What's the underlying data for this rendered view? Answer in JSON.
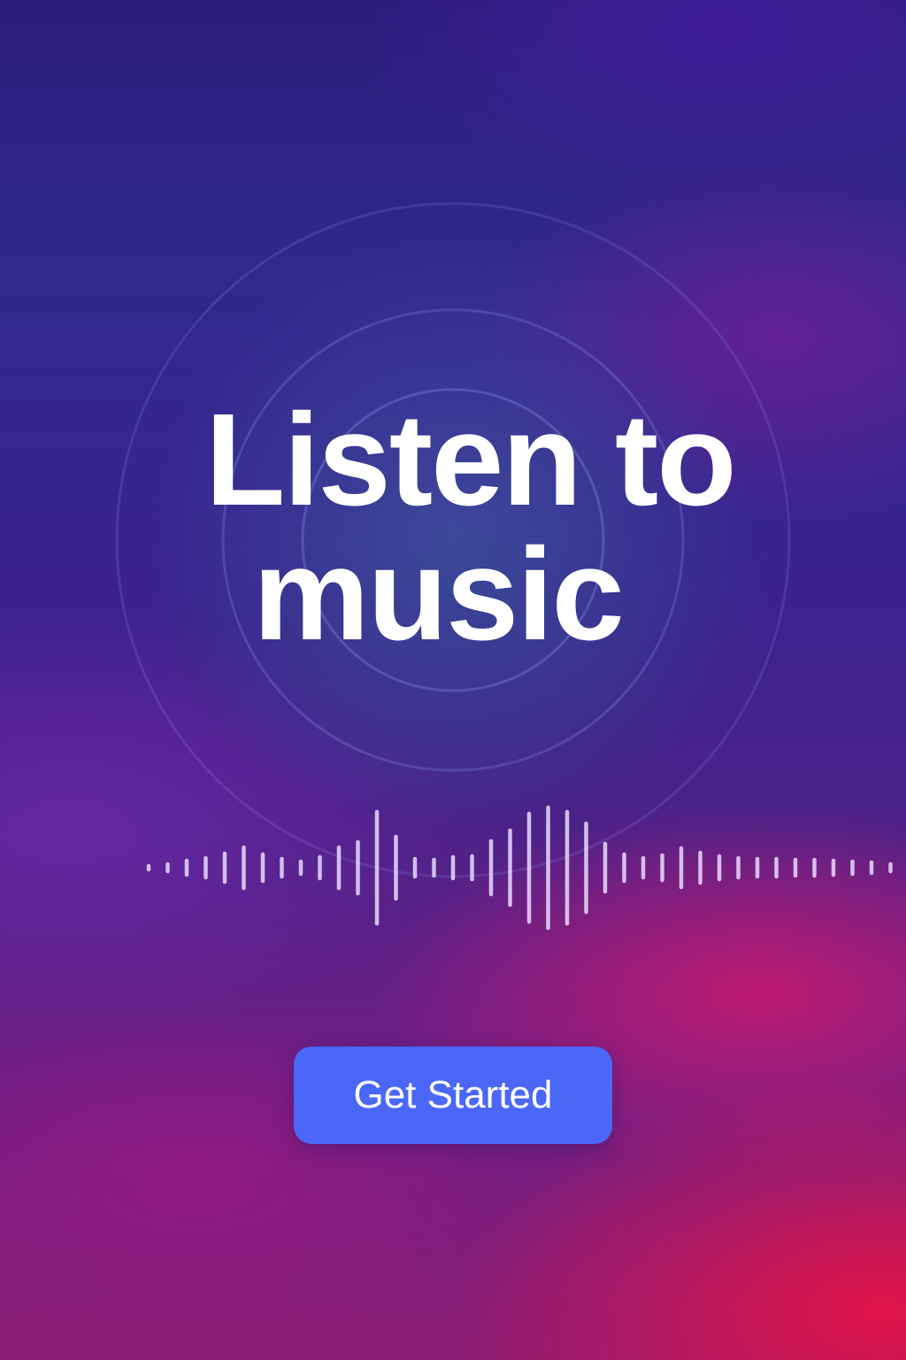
{
  "headline": {
    "line1": "Listen to",
    "line2": "music"
  },
  "cta": {
    "label": "Get Started"
  },
  "colors": {
    "button": "#4a67f7",
    "text": "#ffffff",
    "waveform": "#e9d9ff",
    "background_top": "#2b1c7a",
    "background_bottom": "#e6144a"
  },
  "icons": {
    "waveform": "audio-waveform-icon",
    "rings": "sound-ripple-rings"
  }
}
